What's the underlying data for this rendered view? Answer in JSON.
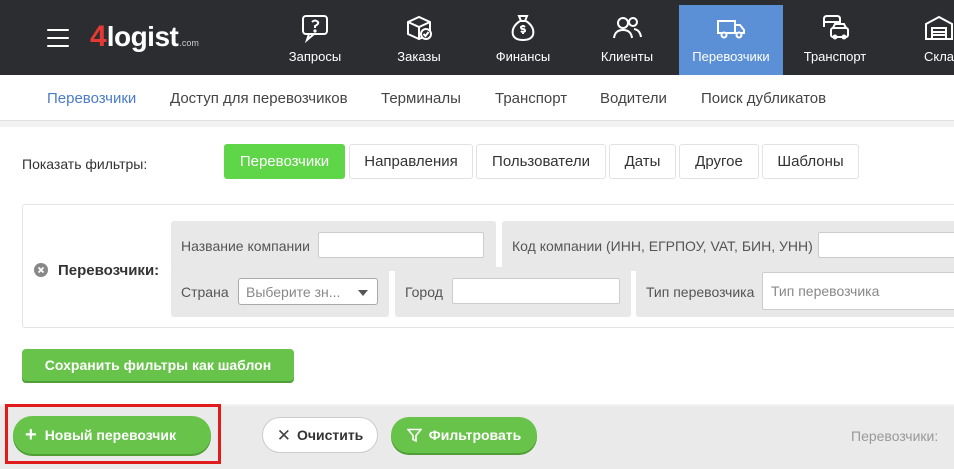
{
  "brand": {
    "four": "4",
    "word": "logist",
    "dom": ".com"
  },
  "nav": [
    {
      "label": "Запросы",
      "icon": "question-chat-icon"
    },
    {
      "label": "Заказы",
      "icon": "box-check-icon"
    },
    {
      "label": "Финансы",
      "icon": "money-bag-icon"
    },
    {
      "label": "Клиенты",
      "icon": "users-icon"
    },
    {
      "label": "Перевозчики",
      "icon": "truck-icon",
      "active": true
    },
    {
      "label": "Транспорт",
      "icon": "vehicles-icon"
    },
    {
      "label": "Скла",
      "icon": "warehouse-icon"
    }
  ],
  "subnav": [
    {
      "label": "Перевозчики",
      "active": true
    },
    {
      "label": "Доступ для перевозчиков"
    },
    {
      "label": "Терминалы"
    },
    {
      "label": "Транспорт"
    },
    {
      "label": "Водители"
    },
    {
      "label": "Поиск дубликатов"
    }
  ],
  "filters": {
    "show_label": "Показать фильтры:",
    "tabs": [
      {
        "label": "Перевозчики",
        "active": true
      },
      {
        "label": "Направления"
      },
      {
        "label": "Пользователи"
      },
      {
        "label": "Даты"
      },
      {
        "label": "Другое"
      },
      {
        "label": "Шаблоны"
      }
    ],
    "box_label": "Перевозчики:",
    "fields": {
      "company_name": {
        "label": "Название компании",
        "value": ""
      },
      "company_code": {
        "label": "Код компании (ИНН, ЕГРПОУ, VAT, БИН, УНН)",
        "value": ""
      },
      "country": {
        "label": "Страна",
        "placeholder": "Выберите зн..."
      },
      "city": {
        "label": "Город",
        "value": ""
      },
      "carrier_type": {
        "label": "Тип перевозчика",
        "placeholder": "Тип перевозчика"
      }
    },
    "save_template": "Сохранить фильтры как шаблон"
  },
  "actions": {
    "new_carrier": "Новый перевозчик",
    "clear": "Очистить",
    "filter": "Фильтровать",
    "count_label": "Перевозчики:"
  },
  "colors": {
    "topbar": "#2b2d31",
    "nav_active": "#5b8fd6",
    "green": "#67c34a",
    "tab_active": "#5ed648",
    "highlight": "#e01b1b"
  }
}
